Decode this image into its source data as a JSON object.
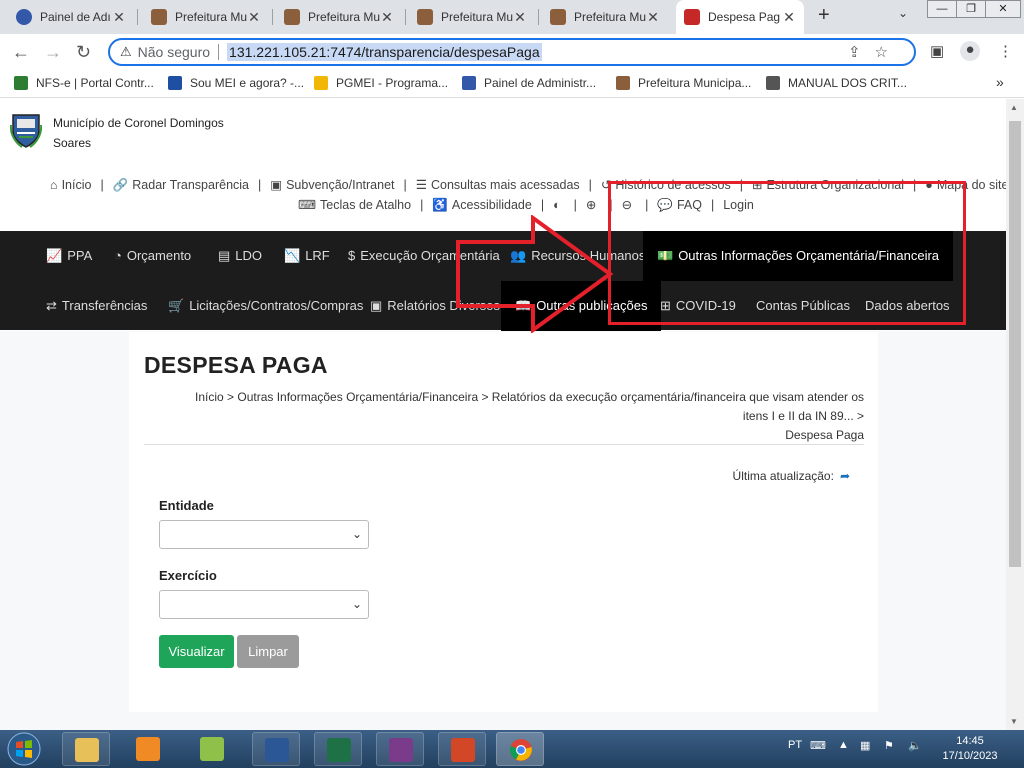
{
  "browser": {
    "tabs": [
      {
        "title": "Painel de Adı",
        "active": false
      },
      {
        "title": "Prefeitura Mu",
        "active": false
      },
      {
        "title": "Prefeitura Mu",
        "active": false
      },
      {
        "title": "Prefeitura Mu",
        "active": false
      },
      {
        "title": "Prefeitura Mu",
        "active": false
      },
      {
        "title": "Despesa Pag",
        "active": true
      }
    ],
    "new_tab_icon": "plus-icon",
    "security_label": "Não seguro",
    "url": "131.221.105.21:7474/transparencia/despesaPaga",
    "bookmarks": [
      {
        "label": "NFS-e | Portal Contr...",
        "color": "#2e7d32"
      },
      {
        "label": "Sou MEI e agora? -...",
        "color": "#1e4fa3"
      },
      {
        "label": "PGMEI - Programa...",
        "color": "#f2b705"
      },
      {
        "label": "Painel de Administr...",
        "color": "#3358a8"
      },
      {
        "label": "Prefeitura Municipa...",
        "color": "#8b5e3c"
      },
      {
        "label": "MANUAL DOS CRIT...",
        "color": "#555555"
      }
    ],
    "bookmarks_more": "»"
  },
  "site": {
    "municipality": "Município de Coronel Domingos Soares",
    "toplinks_row1": [
      {
        "icon": "home-icon",
        "glyph": "⌂",
        "label": "Início"
      },
      {
        "icon": "link-icon",
        "glyph": "🔗",
        "label": "Radar Transparência"
      },
      {
        "icon": "id-card-icon",
        "glyph": "▣",
        "label": "Subvenção/Intranet"
      },
      {
        "icon": "list-icon",
        "glyph": "☰",
        "label": "Consultas mais acessadas"
      },
      {
        "icon": "history-icon",
        "glyph": "↺",
        "label": "Histórico de acessos"
      },
      {
        "icon": "sitemap-icon",
        "glyph": "⊞",
        "label": "Estrutura Organizacional"
      },
      {
        "icon": "map-marker-icon",
        "glyph": "●",
        "label": "Mapa do site"
      }
    ],
    "toplinks_row2": [
      {
        "icon": "keyboard-icon",
        "glyph": "⌨",
        "label": "Teclas de Atalho"
      },
      {
        "icon": "wheelchair-icon",
        "glyph": "♿",
        "label": "Acessibilidade"
      },
      {
        "icon": "contrast-icon",
        "glyph": "◐",
        "label": ""
      },
      {
        "icon": "zoom-in-icon",
        "glyph": "⊕",
        "label": ""
      },
      {
        "icon": "zoom-out-icon",
        "glyph": "⊖",
        "label": ""
      },
      {
        "icon": "comment-icon",
        "glyph": "💬",
        "label": "FAQ"
      },
      {
        "icon": "",
        "glyph": "",
        "label": "Login"
      }
    ],
    "menu_row1": [
      {
        "icon": "chart-line-icon",
        "glyph": "📈",
        "label": "PPA"
      },
      {
        "icon": "pie-chart-icon",
        "glyph": "◔",
        "label": "Orçamento"
      },
      {
        "icon": "file-icon",
        "glyph": "▤",
        "label": "LDO"
      },
      {
        "icon": "area-chart-icon",
        "glyph": "📉",
        "label": "LRF"
      },
      {
        "icon": "dollar-icon",
        "glyph": "$",
        "label": "Execução Orçamentária"
      },
      {
        "icon": "users-icon",
        "glyph": "👥",
        "label": "Recursos Humanos"
      },
      {
        "icon": "money-icon",
        "glyph": "💵",
        "label": "Outras Informações Orçamentária/Financeira"
      }
    ],
    "menu_row2": [
      {
        "icon": "exchange-icon",
        "glyph": "⇄",
        "label": "Transferências"
      },
      {
        "icon": "cart-icon",
        "glyph": "🛒",
        "label": "Licitações/Contratos/Compras"
      },
      {
        "icon": "report-icon",
        "glyph": "▣",
        "label": "Relatórios Diversos"
      },
      {
        "icon": "book-icon",
        "glyph": "📖",
        "label": "Outras publicações"
      },
      {
        "icon": "medkit-icon",
        "glyph": "⊞",
        "label": "COVID-19"
      },
      {
        "icon": "",
        "glyph": "",
        "label": "Contas Públicas"
      },
      {
        "icon": "",
        "glyph": "",
        "label": "Dados abertos"
      }
    ]
  },
  "main": {
    "title": "DESPESA PAGA",
    "breadcrumb_line1": "Início > Outras Informações Orçamentária/Financeira > Relatórios da execução orçamentária/financeira que visam atender os itens I e II da IN 89... >",
    "breadcrumb_line2": "Despesa Paga",
    "last_update_label": "Última atualização:",
    "entity_label": "Entidade",
    "entity_value": "",
    "year_label": "Exercício",
    "year_value": "",
    "visualize_button": "Visualizar",
    "clear_button": "Limpar"
  },
  "taskbar": {
    "language": "PT",
    "time": "14:45",
    "date": "17/10/2023"
  },
  "colors": {
    "menu_bg": "#1c1c1c",
    "active_menu_bg": "#000000",
    "visualize_btn": "#1fa55a",
    "clear_btn": "#9b9b9b",
    "annotation_red": "#e4202a"
  }
}
